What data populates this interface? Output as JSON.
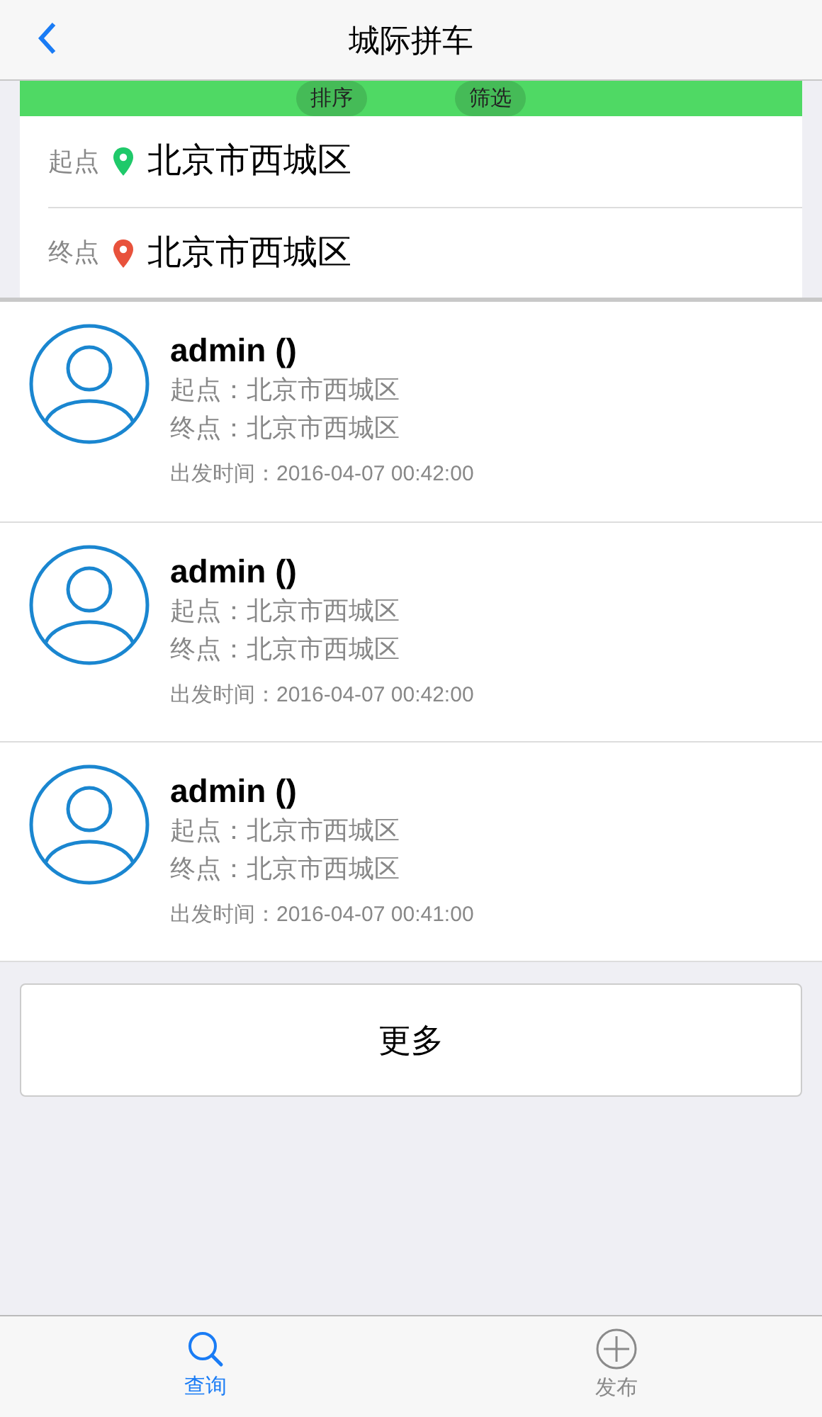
{
  "nav": {
    "title": "城际拼车"
  },
  "filter_bar": [
    "排序",
    "筛选"
  ],
  "route": [
    {
      "label": "起点",
      "color": "#1fc96a",
      "value": "北京市西城区"
    },
    {
      "label": "终点",
      "color": "#e8523c",
      "value": "北京市西城区"
    }
  ],
  "trips": [
    {
      "name": "admin ()",
      "start": "起点：北京市西城区",
      "end": "终点：北京市西城区",
      "time": "出发时间：2016-04-07 00:42:00"
    },
    {
      "name": "admin ()",
      "start": "起点：北京市西城区",
      "end": "终点：北京市西城区",
      "time": "出发时间：2016-04-07 00:42:00"
    },
    {
      "name": "admin ()",
      "start": "起点：北京市西城区",
      "end": "终点：北京市西城区",
      "time": "出发时间：2016-04-07 00:41:00"
    }
  ],
  "more_button": "更多",
  "tabs": [
    {
      "label": "查询",
      "kind": "search",
      "selected": true
    },
    {
      "label": "发布",
      "kind": "add",
      "selected": false
    }
  ]
}
